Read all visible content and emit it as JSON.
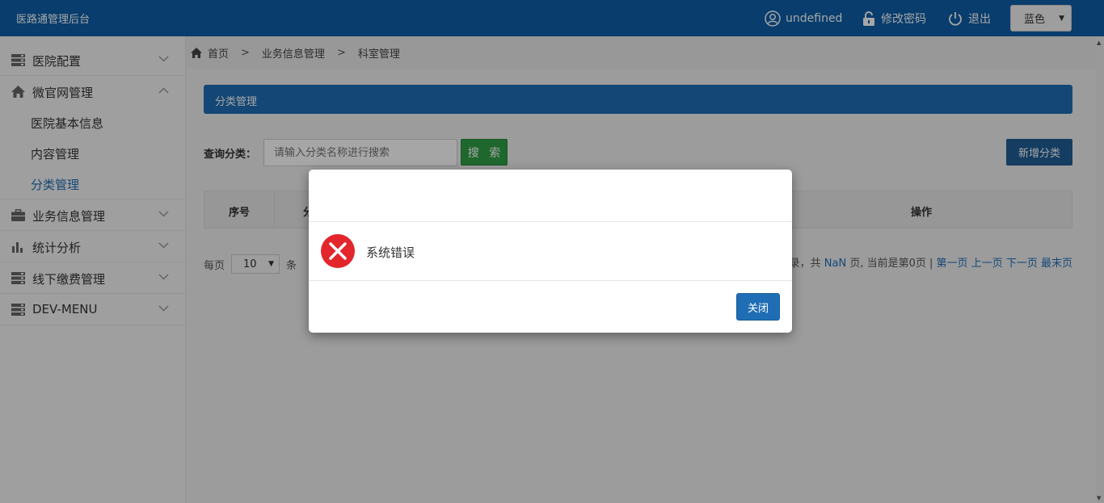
{
  "header": {
    "brand": "医路通管理后台",
    "user": "undefined",
    "change_password": "修改密码",
    "logout": "退出",
    "theme": {
      "selected": "蓝色"
    }
  },
  "sidebar": {
    "items": [
      {
        "label": "医院配置",
        "icon": "server-icon",
        "expanded": false
      },
      {
        "label": "微官网管理",
        "icon": "home-icon",
        "expanded": true,
        "children": [
          {
            "label": "医院基本信息",
            "active": false
          },
          {
            "label": "内容管理",
            "active": false
          },
          {
            "label": "分类管理",
            "active": true
          }
        ]
      },
      {
        "label": "业务信息管理",
        "icon": "briefcase-icon",
        "expanded": false
      },
      {
        "label": "统计分析",
        "icon": "bar-chart-icon",
        "expanded": false
      },
      {
        "label": "线下缴费管理",
        "icon": "server-icon",
        "expanded": false
      },
      {
        "label": "DEV-MENU",
        "icon": "server-icon",
        "expanded": false
      }
    ]
  },
  "breadcrumb": {
    "items": [
      "首页",
      "业务信息管理",
      "科室管理"
    ],
    "separator": ">"
  },
  "panel": {
    "title": "分类管理"
  },
  "search": {
    "label": "查询分类：",
    "placeholder": "请输入分类名称进行搜索",
    "button": "搜 索",
    "add_button": "新增分类"
  },
  "table": {
    "headers": [
      "序号",
      "分",
      "操作"
    ]
  },
  "pager": {
    "per_page_prefix": "每页",
    "per_page_value": "10",
    "per_page_suffix": "条",
    "summary_pre": "录，共",
    "total_pages": "NaN",
    "summary_mid": "页, 当前是第0页 |",
    "first": "第一页",
    "prev": "上一页",
    "next": "下一页",
    "last": "最末页"
  },
  "dialog": {
    "message": "系统错误",
    "close_button": "关闭"
  },
  "colors": {
    "primary": "#1f6eb5",
    "topbar": "#0d5ea8",
    "success": "#2e9e46",
    "error": "#e3262b",
    "link": "#1e6fb9"
  }
}
